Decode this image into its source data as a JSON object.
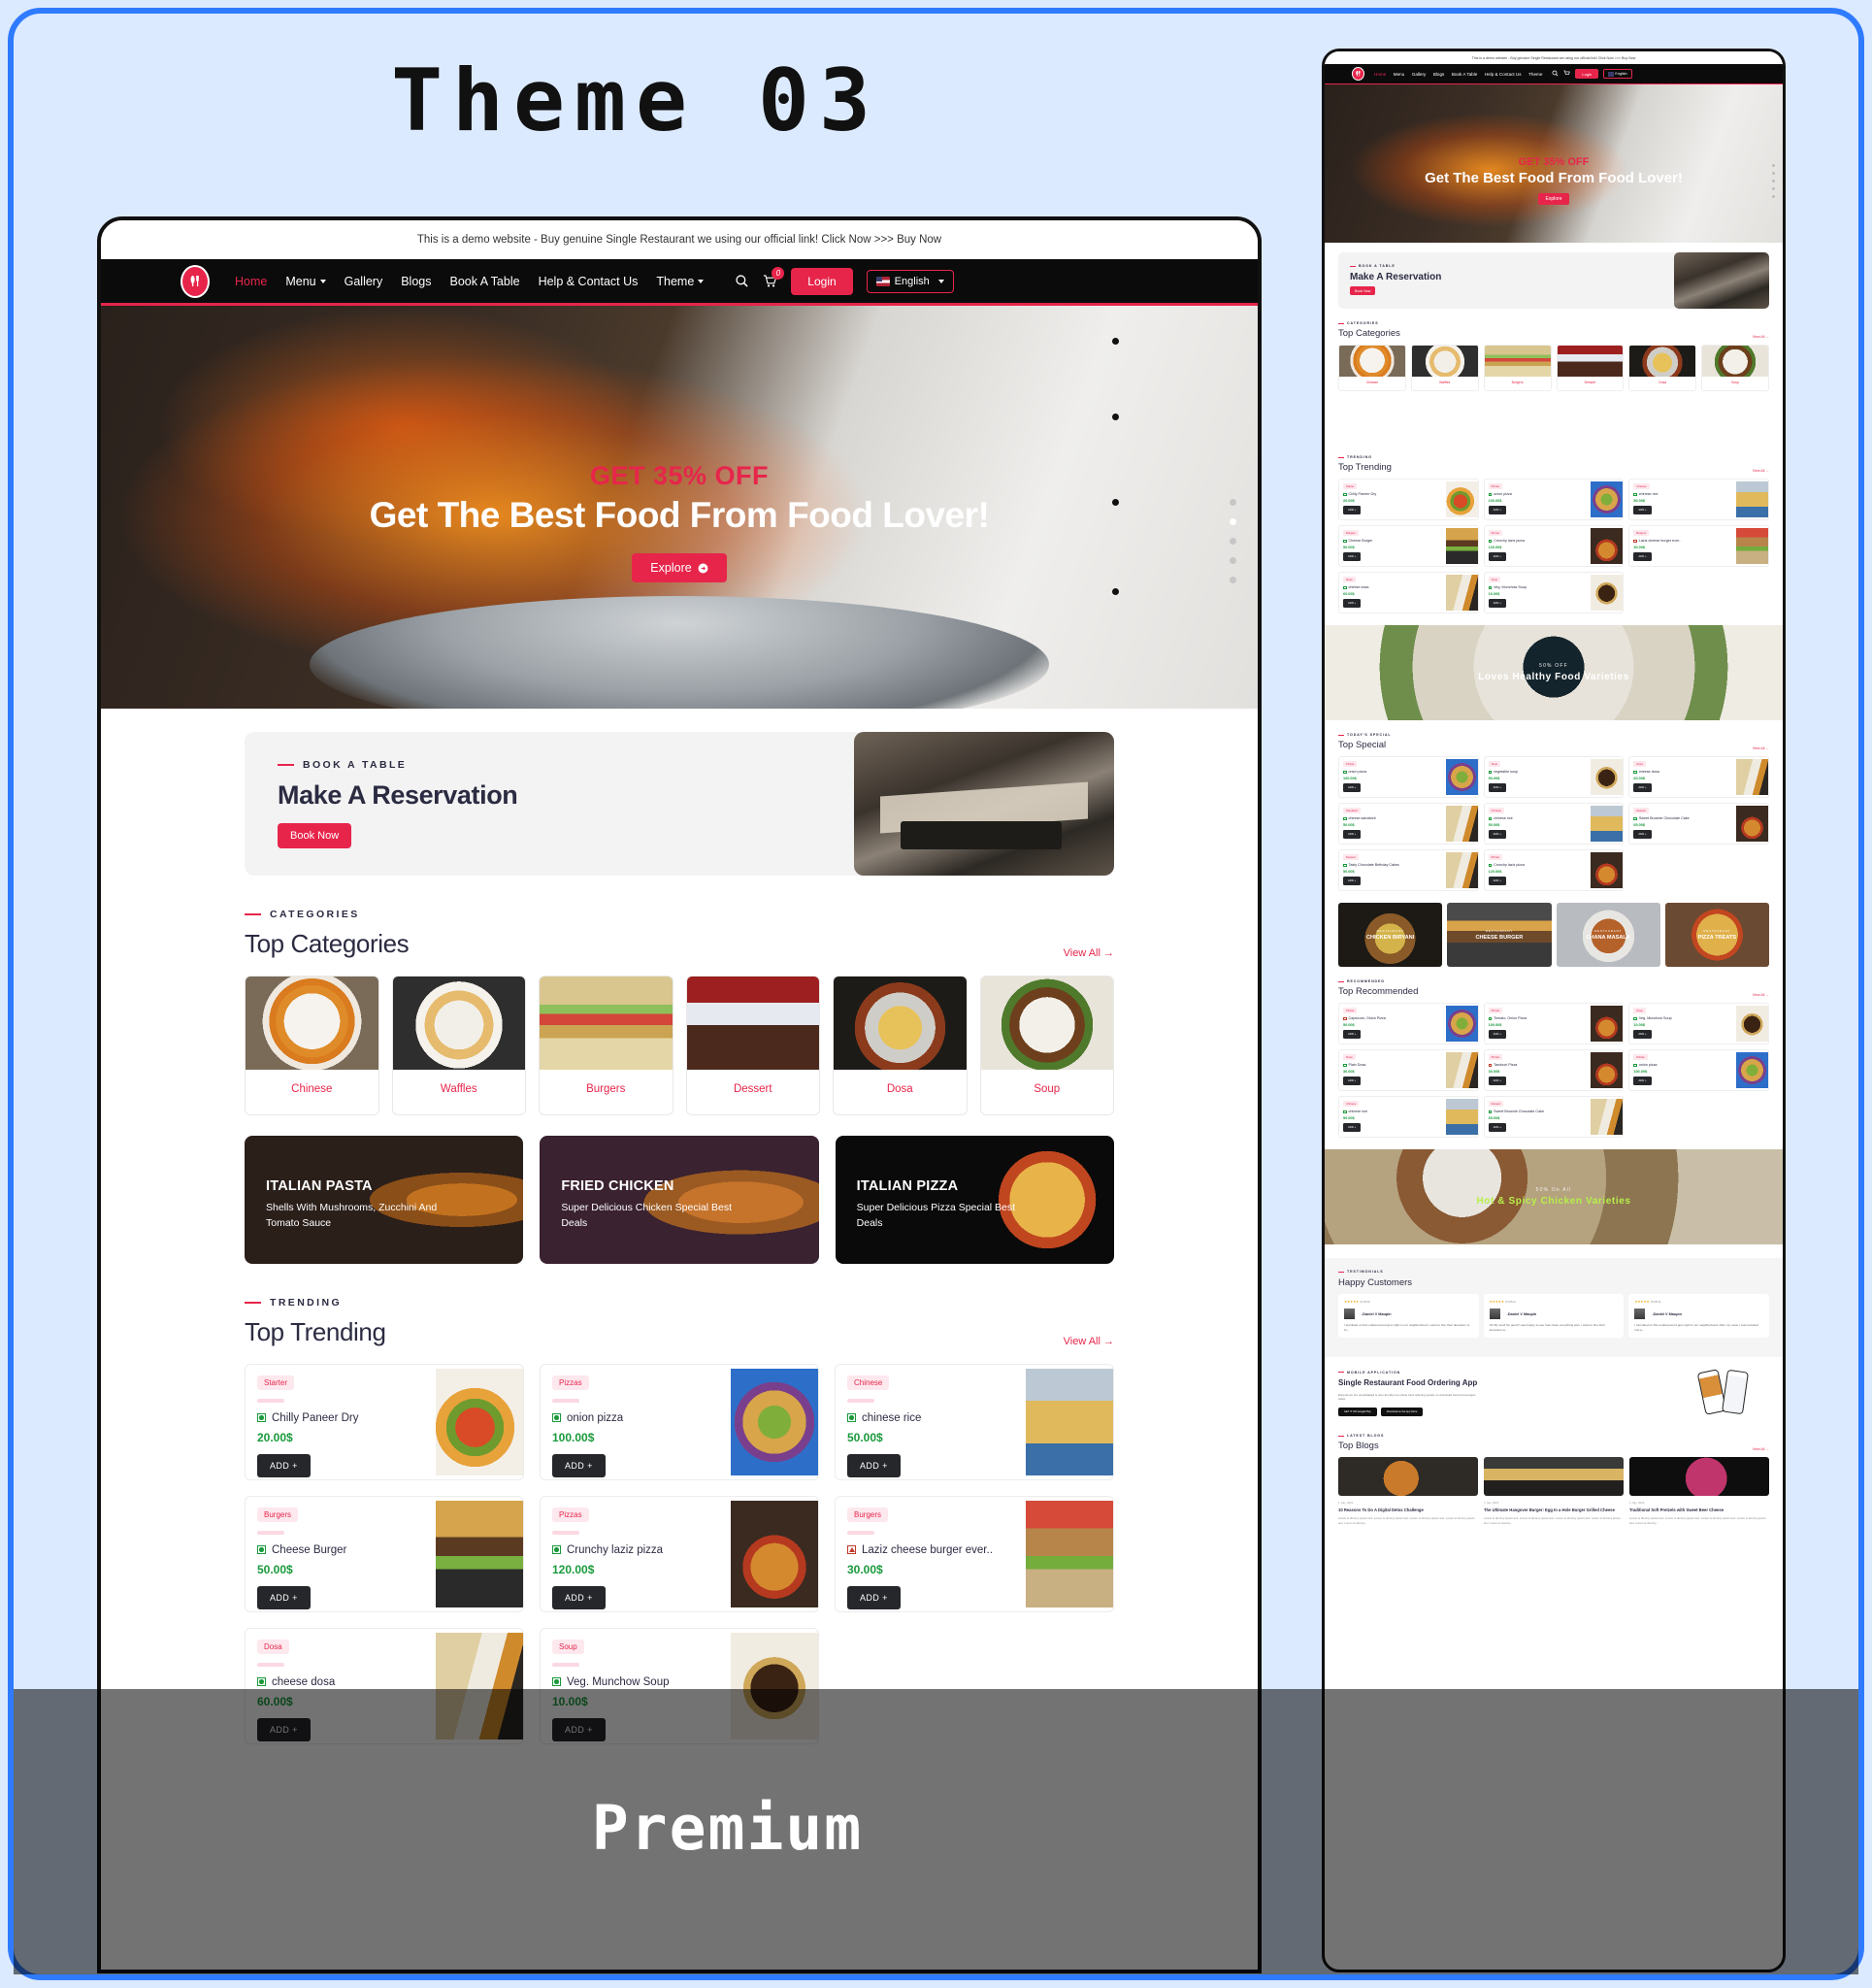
{
  "poster": {
    "theme_title": "Theme 03",
    "premium_label": "Premium"
  },
  "site": {
    "demo_bar": "This is a demo website - Buy genuine Single Restaurant we using our official link! Click Now >>> Buy Now",
    "nav": {
      "links": [
        {
          "label": "Home",
          "active": true
        },
        {
          "label": "Menu",
          "caret": true
        },
        {
          "label": "Gallery"
        },
        {
          "label": "Blogs"
        },
        {
          "label": "Book A Table"
        },
        {
          "label": "Help & Contact Us"
        },
        {
          "label": "Theme",
          "caret": true
        }
      ],
      "search_icon": "search-icon",
      "cart_icon": "cart-icon",
      "cart_count": "0",
      "login_label": "Login",
      "language_label": "English"
    },
    "hero": {
      "offer": "GET 35% OFF",
      "title": "Get The Best Food From Food Lover!",
      "cta": "Explore"
    },
    "reservation": {
      "eyebrow": "BOOK A TABLE",
      "title": "Make A Reservation",
      "cta": "Book Now"
    },
    "categories_section": {
      "eyebrow": "CATEGORIES",
      "title": "Top Categories",
      "view_all": "View All",
      "items": [
        {
          "label": "Chinese",
          "img": "c-chinese"
        },
        {
          "label": "Waffles",
          "img": "c-waffles"
        },
        {
          "label": "Burgers",
          "img": "c-burgers"
        },
        {
          "label": "Dessert",
          "img": "c-dessert"
        },
        {
          "label": "Dosa",
          "img": "c-dosa"
        },
        {
          "label": "Soup",
          "img": "c-soup"
        }
      ]
    },
    "promos": [
      {
        "title": "ITALIAN PASTA",
        "subtitle": "Shells With Mushrooms, Zucchini And Tomato Sauce"
      },
      {
        "title": "FRIED CHICKEN",
        "subtitle": "Super Delicious Chicken Special Best Deals"
      },
      {
        "title": "ITALIAN PIZZA",
        "subtitle": "Super Delicious Pizza Special Best Deals"
      }
    ],
    "trending_section": {
      "eyebrow": "TRENDING",
      "title": "Top Trending",
      "view_all": "View All",
      "add_label": "ADD +",
      "items": [
        {
          "tag": "Starter",
          "name": "Chilly Paneer Dry",
          "price": "20.00$",
          "diet": "veg",
          "img": "i-paneer"
        },
        {
          "tag": "Pizzas",
          "name": "onion pizza",
          "price": "100.00$",
          "diet": "veg",
          "img": "i-onionpizza"
        },
        {
          "tag": "Chinese",
          "name": "chinese rice",
          "price": "50.00$",
          "diet": "veg",
          "img": "i-chinrice"
        },
        {
          "tag": "Burgers",
          "name": "Cheese Burger",
          "price": "50.00$",
          "diet": "veg",
          "img": "i-cheeseburger"
        },
        {
          "tag": "Pizzas",
          "name": "Crunchy laziz pizza",
          "price": "120.00$",
          "diet": "veg",
          "img": "i-crunchypizza"
        },
        {
          "tag": "Burgers",
          "name": "Laziz cheese burger ever..",
          "price": "30.00$",
          "diet": "nonveg",
          "img": "i-lazizburger"
        },
        {
          "tag": "Dosa",
          "name": "cheese dosa",
          "price": "60.00$",
          "diet": "veg",
          "img": "i-cheesedosa"
        },
        {
          "tag": "Soup",
          "name": "Veg. Munchow Soup",
          "price": "10.00$",
          "diet": "veg",
          "img": "i-munchow"
        }
      ]
    },
    "healthy_banner": {
      "sub": "50% OFF",
      "title": "Loves Healthy Food Varieties"
    },
    "special_section": {
      "eyebrow": "TODAY'S SPECIAL",
      "title": "Top Special",
      "view_all": "View All",
      "items": [
        {
          "tag": "Pizzas",
          "name": "onion pizza",
          "price": "100.00$",
          "diet": "veg"
        },
        {
          "tag": "Soup",
          "name": "vegetable soup",
          "price": "50.00$",
          "diet": "veg"
        },
        {
          "tag": "Dosa",
          "name": "cheese dosa",
          "price": "60.00$",
          "diet": "veg"
        },
        {
          "tag": "Sandwich",
          "name": "cheese sandwich",
          "price": "50.00$",
          "diet": "veg"
        },
        {
          "tag": "Chinese",
          "name": "chinese rice",
          "price": "50.00$",
          "diet": "veg"
        },
        {
          "tag": "Dessert",
          "name": "Sweet Brownie Chocolate Cake",
          "price": "65.00$",
          "diet": "veg"
        },
        {
          "tag": "Dessert",
          "name": "Tasty Chocolate Birthday Cakes",
          "price": "50.00$",
          "diet": "veg"
        },
        {
          "tag": "Pizzas",
          "name": "Crunchy laziz pizza",
          "price": "120.00$",
          "diet": "veg"
        }
      ]
    },
    "restaurants": [
      {
        "sub": "RESTAURANT",
        "title": "CHICKEN BIRYANI"
      },
      {
        "sub": "RESTAURANT",
        "title": "CHEESE BURGER"
      },
      {
        "sub": "RESTAURANT",
        "title": "CHANA MASALA"
      },
      {
        "sub": "RESTAURANT",
        "title": "PIZZA TREATS"
      }
    ],
    "recommended_section": {
      "eyebrow": "RECOMMENDED",
      "title": "Top Recommended",
      "view_all": "View All",
      "items": [
        {
          "tag": "Pizzas",
          "name": "Capsicum, Onion Pizza",
          "price": "50.00$",
          "diet": "nonveg"
        },
        {
          "tag": "Pizzas",
          "name": "Tomato, Onion Pizza",
          "price": "100.00$",
          "diet": "veg"
        },
        {
          "tag": "Soup",
          "name": "Veg. Munchow Soup",
          "price": "10.00$",
          "diet": "veg"
        },
        {
          "tag": "Dosa",
          "name": "Plain Dosa",
          "price": "30.00$",
          "diet": "veg"
        },
        {
          "tag": "Pizzas",
          "name": "Tandoori Pizza",
          "price": "30.00$",
          "diet": "nonveg"
        },
        {
          "tag": "Pizzas",
          "name": "onion pizza",
          "price": "100.00$",
          "diet": "veg"
        },
        {
          "tag": "Chinese",
          "name": "chinese rice",
          "price": "50.00$",
          "diet": "veg"
        },
        {
          "tag": "Dessert",
          "name": "Sweet Brownie Chocolate Cake",
          "price": "65.00$",
          "diet": "veg"
        }
      ]
    },
    "spicy_banner": {
      "sub": "50% On All",
      "title": "Hot & Spicy Chicken Varieties"
    },
    "testimonials_section": {
      "eyebrow": "TESTIMONIALS",
      "title": "Happy Customers",
      "items": [
        {
          "stars": "★★★★★",
          "rating": "(5.0/5.0)",
          "name": "-Daniel V Maupin",
          "text": "I stumbled on this undiscovered gem right in our neighborhood. I want to hire their decorator to fu..."
        },
        {
          "stars": "★★★★★",
          "rating": "(5.0/5.0)",
          "name": "-Daniel V Maupin",
          "text": "Oh My God! So good! I was happy to see how clean everything was. I want to hire their decorator to..."
        },
        {
          "stars": "★★★★★",
          "rating": "(5.0/5.0)",
          "name": "-Daniel V Maupin",
          "text": "I stumbled on this undiscovered gem right in our neighborhood. After my meal, I was knocked into a..."
        }
      ]
    },
    "app_section": {
      "eyebrow": "MOBILE APPLICATION",
      "title": "Single Restaurant Food Ordering App",
      "text": "Experience the unparalleled & user-friendly top online food ordering system to download food & beverages sales.",
      "stores": [
        "GET IT ON Google Play",
        "Download on the App Store"
      ]
    },
    "blogs_section": {
      "eyebrow": "LATEST BLOGS",
      "title": "Top Blogs",
      "view_all": "View All",
      "items": [
        {
          "date": "1 July, 2022",
          "title": "10 Reasons To Do A Digital Detox Challenge",
          "excerpt": "Lorem is dummy ipsum text. Lorem is dummy ipsum text. Lorem is dummy ipsum text. Lorem is dummy ipsum text. Lorem is dummy..."
        },
        {
          "date": "1 July, 2022",
          "title": "The Ultimate Hangover Burger: Egg In a Hole Burger Grilled Cheese",
          "excerpt": "Lorem is dummy ipsum text. Lorem is dummy ipsum text. Lorem is dummy ipsum text. Lorem is dummy ipsum text. Lorem is dummy..."
        },
        {
          "date": "1 July, 2022",
          "title": "Traditional Soft Pretzels with Sweet Beer Cheese",
          "excerpt": "Lorem is dummy ipsum text. Lorem is dummy ipsum text. Lorem is dummy ipsum text. Lorem is dummy ipsum text. Lorem is dummy..."
        }
      ]
    },
    "colors": {
      "accent": "#e7254b",
      "dark": "#2b2b42",
      "price_green": "#1a9a3c",
      "nav_black": "#0b0b0b",
      "frame_blue": "#2f7bff"
    }
  }
}
